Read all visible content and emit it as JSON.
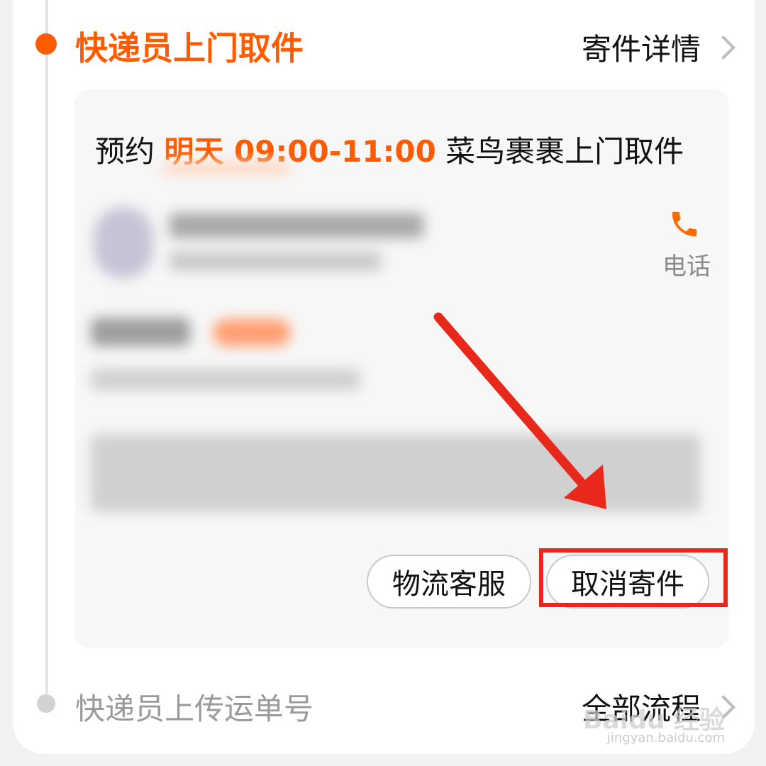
{
  "steps": {
    "current": {
      "title": "快递员上门取件",
      "link": "寄件详情"
    },
    "next": {
      "title": "快递员上传运单号",
      "link": "全部流程"
    }
  },
  "appointment": {
    "prefix": "预约 ",
    "day": "明天",
    "time": " 09:00-11:00",
    "suffix": " 菜鸟裹裹上门取件"
  },
  "courier": {
    "phone_label": "电话",
    "phone_icon": "phone-icon"
  },
  "actions": {
    "service_label": "物流客服",
    "cancel_label": "取消寄件"
  },
  "watermark": {
    "brand": "Baidu 经验",
    "url": "jingyan.baidu.com"
  },
  "colors": {
    "accent": "#ff5b00",
    "annotation": "#e8281b"
  }
}
